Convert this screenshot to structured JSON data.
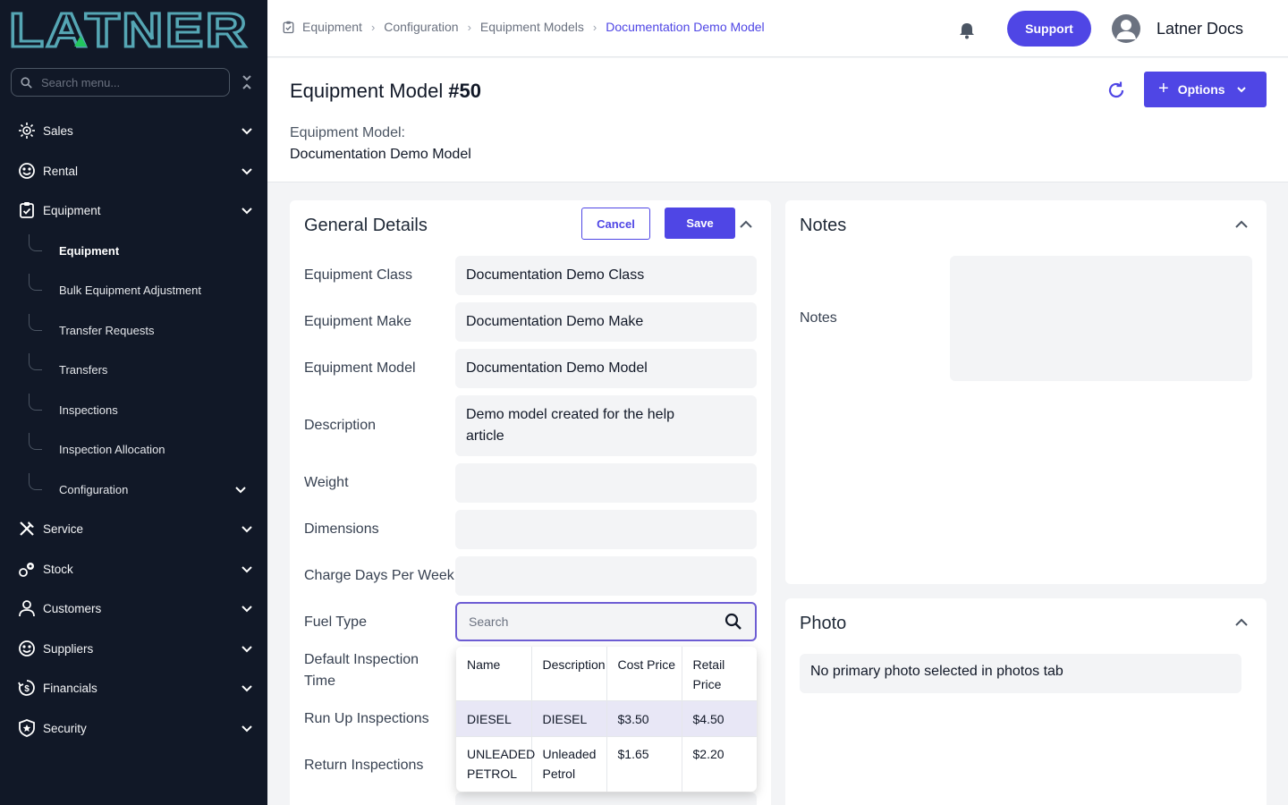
{
  "brand": {
    "logo_text": "LATNER"
  },
  "sidebar": {
    "search_placeholder": "Search menu...",
    "items": [
      {
        "label": "Sales",
        "icon": "sales-icon"
      },
      {
        "label": "Rental",
        "icon": "rental-icon"
      },
      {
        "label": "Equipment",
        "icon": "equipment-icon"
      },
      {
        "label": "Service",
        "icon": "service-icon"
      },
      {
        "label": "Stock",
        "icon": "stock-icon"
      },
      {
        "label": "Customers",
        "icon": "customers-icon"
      },
      {
        "label": "Suppliers",
        "icon": "suppliers-icon"
      },
      {
        "label": "Financials",
        "icon": "financials-icon"
      },
      {
        "label": "Security",
        "icon": "security-icon"
      }
    ],
    "equipment_sub": [
      "Equipment",
      "Bulk Equipment Adjustment",
      "Transfer Requests",
      "Transfers",
      "Inspections",
      "Inspection Allocation",
      "Configuration"
    ]
  },
  "topbar": {
    "breadcrumb": [
      "Equipment",
      "Configuration",
      "Equipment Models",
      "Documentation Demo Model"
    ],
    "support_label": "Support",
    "user_name": "Latner Docs"
  },
  "header": {
    "title": "Equipment Model",
    "record_number": "#50",
    "options_label": "Options",
    "model_label": "Equipment Model:",
    "model_value": "Documentation Demo Model"
  },
  "general": {
    "title": "General Details",
    "cancel_label": "Cancel",
    "save_label": "Save",
    "fields": [
      {
        "label": "Equipment Class",
        "value": "Documentation Demo Class"
      },
      {
        "label": "Equipment Make",
        "value": "Documentation Demo Make"
      },
      {
        "label": "Equipment Model",
        "value": "Documentation Demo Model"
      },
      {
        "label": "Description",
        "value": "Demo model created for the help article"
      },
      {
        "label": "Weight",
        "value": ""
      },
      {
        "label": "Dimensions",
        "value": ""
      },
      {
        "label": "Charge Days Per Week",
        "value": ""
      }
    ],
    "fuel_label": "Fuel Type",
    "fuel_placeholder": "Search",
    "more_labels": [
      "Default Inspection Time",
      "Run Up Inspections",
      "Return Inspections"
    ],
    "fuel_table": {
      "columns": [
        "Name",
        "Description",
        "Cost Price",
        "Retail Price"
      ],
      "rows": [
        [
          "DIESEL",
          "DIESEL",
          "$3.50",
          "$4.50"
        ],
        [
          "UNLEADED PETROL",
          "Unleaded Petrol",
          "$1.65",
          "$2.20"
        ]
      ]
    }
  },
  "notes": {
    "title": "Notes",
    "label": "Notes"
  },
  "photo": {
    "title": "Photo",
    "message": "No primary photo selected in photos tab"
  },
  "colors": {
    "accent": "#4f46e5",
    "sidebar_bg": "#111827",
    "logo": "#55a6b4"
  }
}
